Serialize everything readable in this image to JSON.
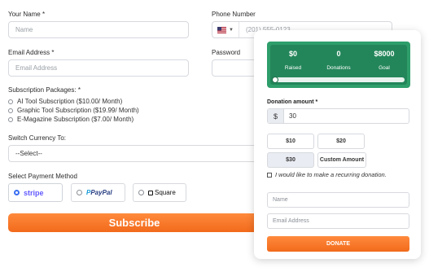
{
  "form": {
    "name": {
      "label": "Your Name *",
      "placeholder": "Name"
    },
    "phone": {
      "label": "Phone Number",
      "flag": "us-flag",
      "value": "(201) 555-0123"
    },
    "email": {
      "label": "Email Address *",
      "placeholder": "Email Address"
    },
    "password": {
      "label": "Password"
    },
    "packages": {
      "label": "Subscription Packages: *",
      "options": [
        "AI Tool Subscription ($10.00/ Month)",
        "Graphic Tool Subscription ($19.99/ Month)",
        "E-Magazine Subscription ($7.00/ Month)"
      ]
    },
    "currency": {
      "label": "Switch Currency To:",
      "selected": "--Select--"
    },
    "payment": {
      "label": "Select Payment Method",
      "methods": [
        {
          "name": "stripe",
          "selected": true
        },
        {
          "name": "PayPal",
          "selected": false
        },
        {
          "name": "Square",
          "selected": false
        }
      ]
    },
    "subscribe_label": "Subscribe"
  },
  "donation": {
    "stats": [
      {
        "value": "$0",
        "label": "Raised"
      },
      {
        "value": "0",
        "label": "Donations"
      },
      {
        "value": "$8000",
        "label": "Goal"
      }
    ],
    "progress": 0,
    "amount_label": "Donation amount *",
    "currency_symbol": "$",
    "amount_value": "30",
    "presets": [
      "$10",
      "$20",
      "$30",
      "Custom Amount"
    ],
    "selected_preset": "$30",
    "recurring_label": "I would like to make a recurring donation.",
    "name_placeholder": "Name",
    "email_placeholder": "Email Address",
    "donate_label": "DONATE"
  },
  "colors": {
    "accent_orange": "#f26a1b",
    "green": "#2e9e6b",
    "stripe_blue": "#635bff"
  }
}
